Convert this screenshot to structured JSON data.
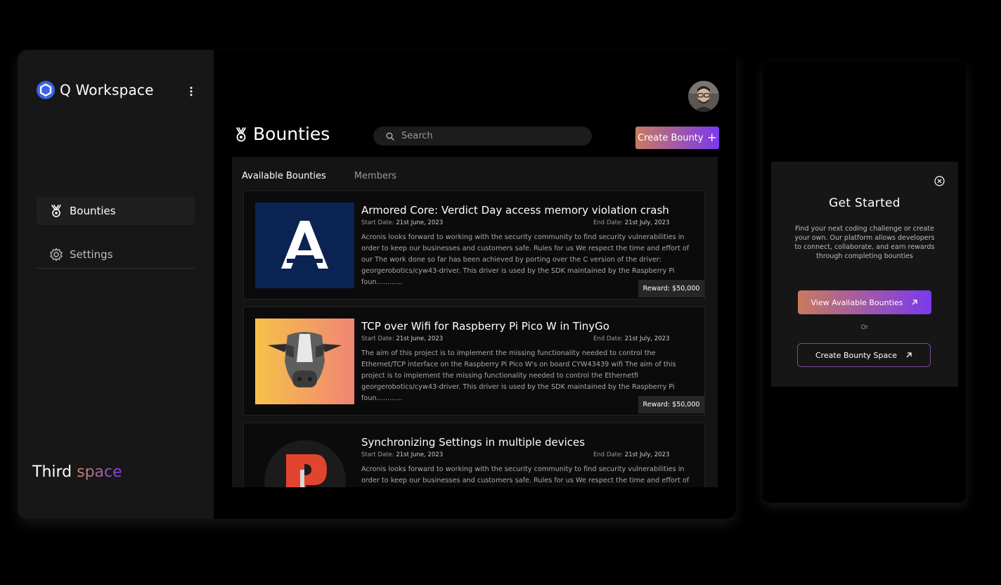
{
  "app": {
    "name": "Q Workspace",
    "footer_brand_first": "Third",
    "footer_brand_second": "space"
  },
  "sidebar": {
    "items": [
      {
        "label": "Bounties",
        "icon": "bounty-icon"
      },
      {
        "label": "Settings",
        "icon": "gear-icon"
      }
    ]
  },
  "header": {
    "title": "Bounties",
    "search_placeholder": "Search",
    "create_label": "Create Bounty",
    "create_icon": "+"
  },
  "tabs": [
    {
      "label": "Available Bounties"
    },
    {
      "label": "Members"
    }
  ],
  "labels": {
    "start": "Start Date:",
    "end": "End Date:"
  },
  "bounties": [
    {
      "title": "Armored Core: Verdict Day access memory violation crash",
      "start_date": "21st June, 2023",
      "end_date": "21st July, 2023",
      "description": "Acronis looks forward to working with the security community to find security vulnerabilities in order to keep our businesses and customers safe. Rules for us We respect the time and effort of our The work done so far has been achieved by porting over the C version of the driver: georgerobotics/cyw43-driver. This driver is used by the SDK maintained by the Raspberry Pi foun............",
      "reward": "Reward: $50,000"
    },
    {
      "title": "TCP over Wifi for Raspberry Pi Pico W in TinyGo",
      "start_date": "21st June, 2023",
      "end_date": "21st July, 2023",
      "description": "The aim of this project is to implement the missing functionality needed to control the Ethernet/TCP interface on the Raspberry Pi Pico W's on board CYW43439 wifi The aim of this project is to implement the missing functionality needed to control the Ethernetfi georgerobotics/cyw43-driver. This driver is used by the SDK maintained by the Raspberry Pi foun............",
      "reward": "Reward: $50,000"
    },
    {
      "title": "Synchronizing Settings in multiple devices",
      "start_date": "21st June, 2023",
      "end_date": "21st July, 2023",
      "description": "Acronis looks forward to working with the security community to find security vulnerabilities in order to keep our businesses and customers safe. Rules for us We respect the time and effort of our The work"
    }
  ],
  "get_started": {
    "title": "Get Started",
    "description": "Find your next coding challenge or create your own. Our platform allows developers to connect, collaborate, and earn rewards through completing bounties",
    "view_button": "View Available Bounties",
    "or": "Or",
    "create_button": "Create Bounty Space"
  },
  "colors": {
    "accent_start": "#c87a5f",
    "accent_end": "#7b39ee",
    "logo_blue": "#3b63e6"
  }
}
